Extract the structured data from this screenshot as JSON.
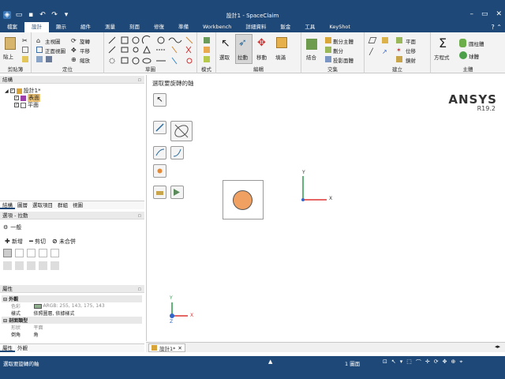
{
  "window": {
    "title": "設計1 - SpaceClaim"
  },
  "menu": {
    "tabs": [
      "檔案",
      "設計",
      "顯示",
      "組件",
      "測量",
      "刻面",
      "修復",
      "準備",
      "Workbench",
      "詳細資料",
      "鈑金",
      "工具",
      "KeyShot"
    ],
    "active": "設計"
  },
  "ribbon": {
    "clipboard": {
      "label": "剪貼簿",
      "paste": "貼上"
    },
    "orient": {
      "label": "定位",
      "home": "主視圖",
      "plan": "正面視圖",
      "spin": "旋轉",
      "pan": "平移",
      "zoom": "縮放"
    },
    "sketch": {
      "label": "草圖"
    },
    "mode": {
      "label": "模式"
    },
    "edit": {
      "label": "編輯",
      "select": "選取",
      "pull": "拉動",
      "move": "移動",
      "fill": "填滿"
    },
    "intersect": {
      "label": "交集",
      "combine": "結合",
      "split_body": "劃分主體",
      "split": "劃分",
      "project": "投影面體"
    },
    "create": {
      "label": "建立",
      "plane": "平面",
      "axis": "軸",
      "point": "位移",
      "origin": "鏡射"
    },
    "body": {
      "label": "主體",
      "equation": "方程式",
      "cylinder": "圓柱體",
      "sphere": "球體"
    }
  },
  "structure": {
    "header": "結構",
    "pin": "▫",
    "tree": [
      {
        "label": "設計1*",
        "level": 0
      },
      {
        "label": "表面",
        "level": 1,
        "highlight": true
      },
      {
        "label": "平面",
        "level": 1
      }
    ],
    "tabs": [
      "結構",
      "圖層",
      "選取項目",
      "群組",
      "視圖"
    ]
  },
  "options": {
    "header": "選項 - 拉動",
    "section": "一般",
    "add": "新增",
    "cut": "剪切",
    "no_merge": "未合併"
  },
  "properties": {
    "header": "屬性",
    "group1": "外觀",
    "rows1": [
      {
        "k": "色彩",
        "v": "ARGB: 255, 143, 175, 143"
      },
      {
        "k": "樣式",
        "v": "依照圖層, 依據樣式"
      }
    ],
    "group2": "剖面類型",
    "rows2": [
      {
        "k": "形狀",
        "v": "平面"
      },
      {
        "k": "倒角",
        "v": "角"
      }
    ],
    "tabs": [
      "屬性",
      "外觀"
    ]
  },
  "viewport": {
    "prompt": "選取要旋轉的軸",
    "brand": "ANSYS",
    "version": "R19.2",
    "axis_x": "X",
    "axis_y": "Y",
    "axis_z": "Z",
    "disk_color": "#f0a060",
    "doc_tab": "設計1*"
  },
  "status": {
    "message": "選取要旋轉的軸",
    "count": "1 圖面"
  },
  "colors": {
    "titlebar": "#1e4877",
    "swatch": "#8faf8f",
    "ansys_text": "#333333"
  }
}
